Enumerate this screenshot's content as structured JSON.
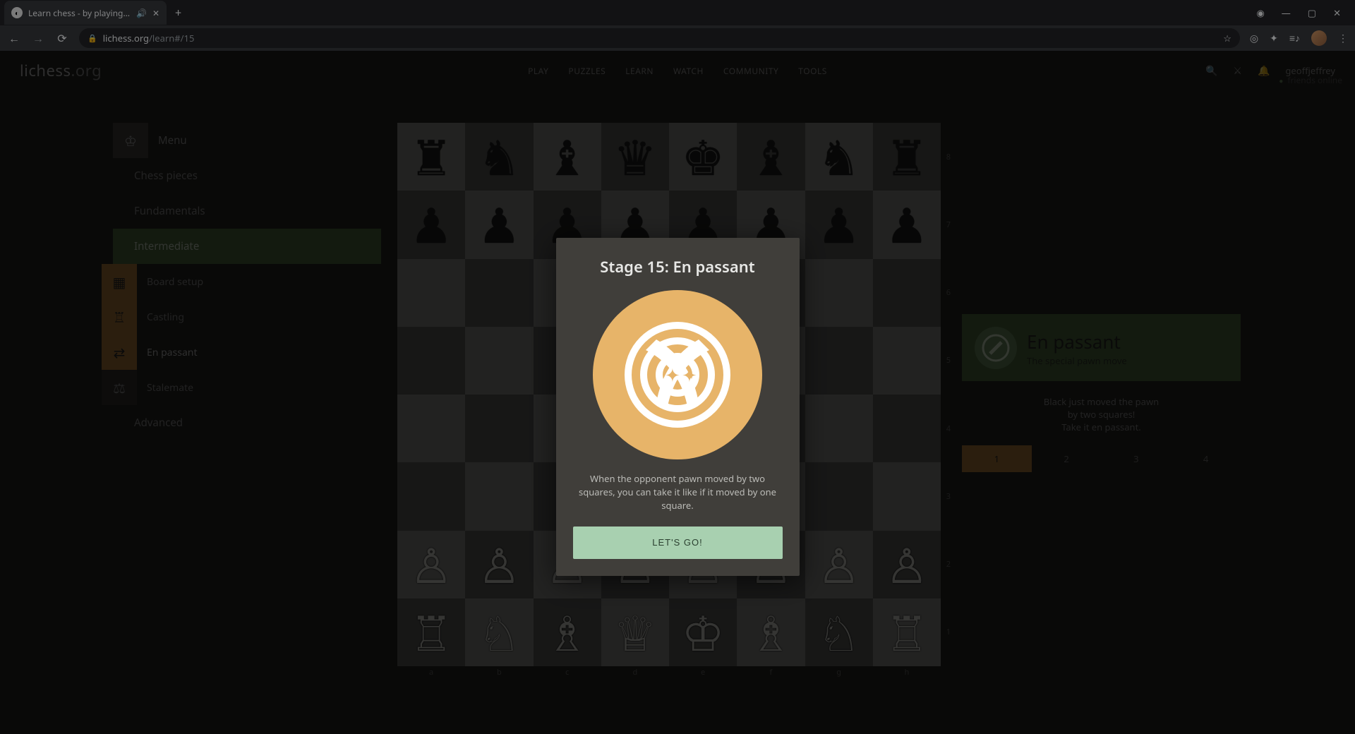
{
  "browser": {
    "tab_title": "Learn chess - by playing! • lic",
    "url_host": "lichess.org",
    "url_path": "/learn#/15"
  },
  "brand": {
    "name": "lichess",
    "tld": ".org"
  },
  "topnav": {
    "items": [
      "PLAY",
      "PUZZLES",
      "LEARN",
      "WATCH",
      "COMMUNITY",
      "TOOLS"
    ]
  },
  "user": {
    "name": "geoffjeffrey"
  },
  "sidebar": {
    "menu_label": "Menu",
    "sections": [
      {
        "label": "Chess pieces",
        "active": false
      },
      {
        "label": "Fundamentals",
        "active": false
      },
      {
        "label": "Intermediate",
        "active": true,
        "items": [
          {
            "label": "Board setup",
            "icon": "board-icon",
            "active": false
          },
          {
            "label": "Castling",
            "icon": "castle-icon",
            "active": false
          },
          {
            "label": "En passant",
            "icon": "swap-icon",
            "active": true
          },
          {
            "label": "Stalemate",
            "icon": "scale-icon",
            "active": false
          }
        ]
      },
      {
        "label": "Advanced",
        "active": false
      }
    ]
  },
  "board": {
    "ranks": [
      "8",
      "7",
      "6",
      "5",
      "4",
      "3",
      "2",
      "1"
    ],
    "files": [
      "a",
      "b",
      "c",
      "d",
      "e",
      "f",
      "g",
      "h"
    ],
    "position_fen": "rnbqkbnr/pppppppp/8/8/8/8/PPPPPPPP/RNBQKBNR"
  },
  "right_panel": {
    "title": "En passant",
    "subtitle": "The special pawn move",
    "instruction_lines": [
      "Black just moved the pawn",
      "by two squares!",
      "Take it en passant."
    ],
    "steps": [
      "1",
      "2",
      "3",
      "4"
    ],
    "active_step": 0
  },
  "modal": {
    "title": "Stage 15: En passant",
    "description": "When the opponent pawn moved by two squares, you can take it like if it moved by one square.",
    "button": "LET'S GO!"
  },
  "footer": {
    "friends": "friends online"
  }
}
